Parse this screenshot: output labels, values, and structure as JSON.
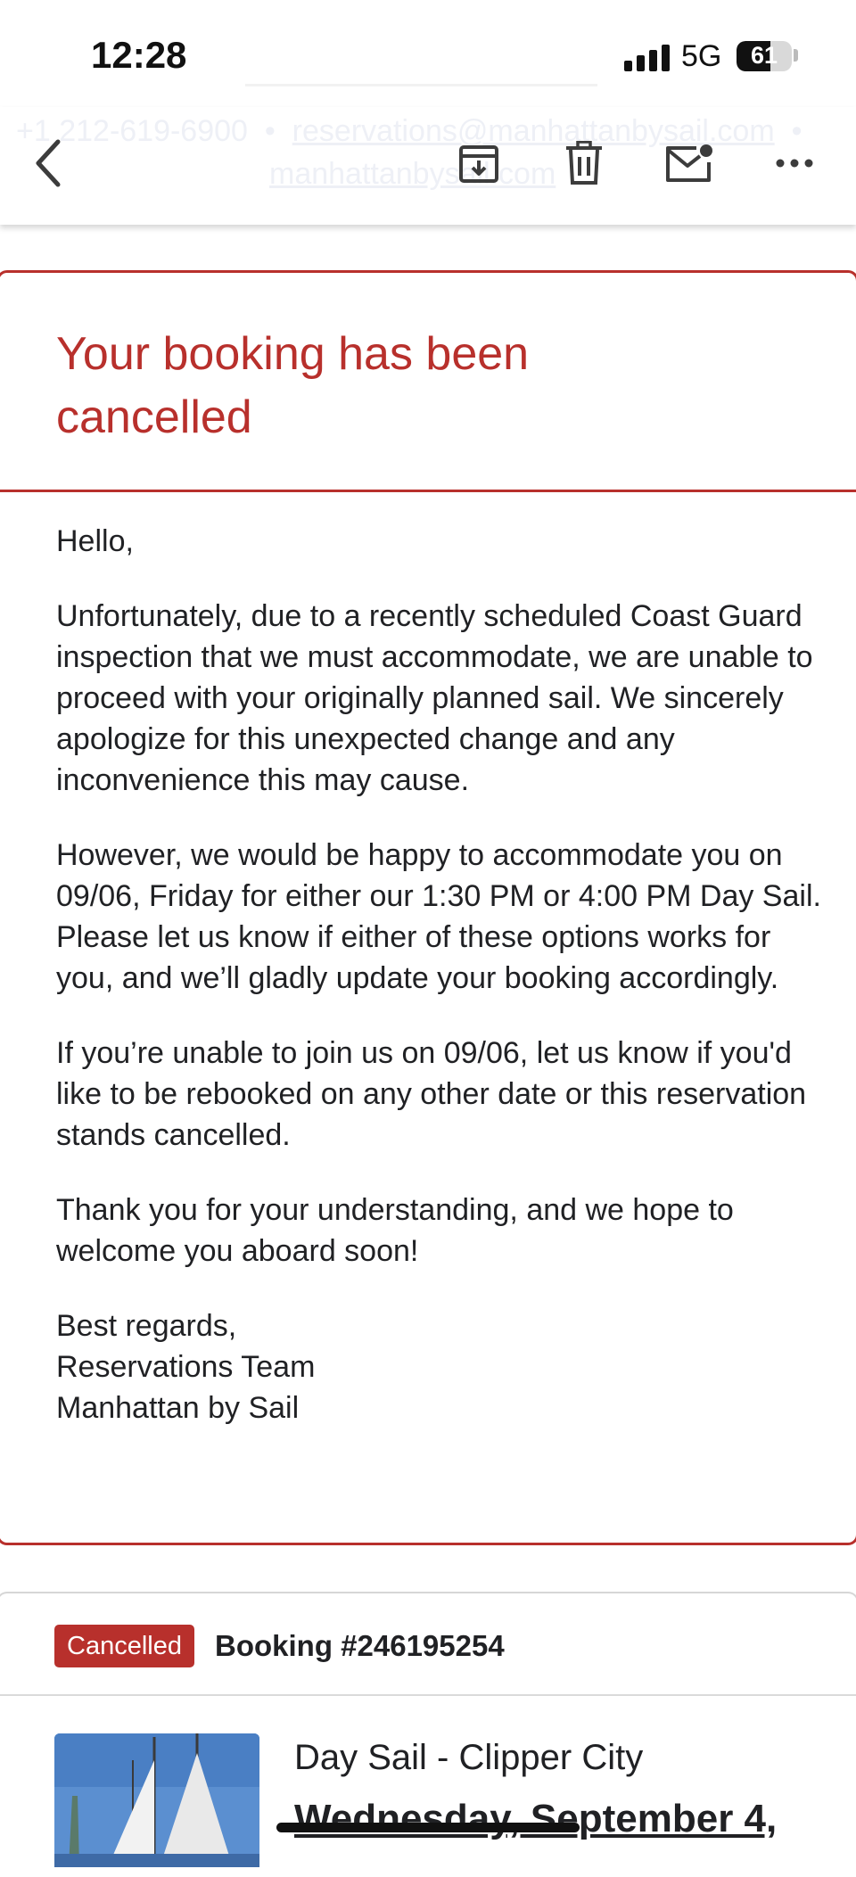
{
  "status_bar": {
    "time": "12:28",
    "network": "5G",
    "battery": "61",
    "battery_level": 0.61
  },
  "background_header": {
    "phone": "+1 212-619-6900",
    "separator": "•",
    "email": "reservations@manhattanbysail.com",
    "website": "manhattanbysail.com"
  },
  "toolbar": {
    "icons": [
      "back-arrow-icon",
      "archive-icon",
      "trash-icon",
      "mark-unread-icon",
      "more-icon"
    ]
  },
  "cancellation": {
    "title": "Your booking has been cancelled",
    "greeting": "Hello,",
    "paragraph_1": "Unfortunately, due to a recently scheduled Coast Guard inspection that we must accommodate, we are unable to proceed with your originally planned sail. We sincerely apologize for this unexpected change and any inconvenience this may cause.",
    "paragraph_2": "However, we would be happy to accommodate you on 09/06, Friday for either our 1:30 PM or 4:00 PM Day Sail. Please let us know if either of these options works for you, and we’ll gladly update your booking accordingly.",
    "paragraph_3": "If you’re unable to join us on 09/06, let us know if you'd like to be rebooked on any other date or this reservation stands cancelled.",
    "paragraph_4": "Thank you for your understanding, and we hope to welcome you aboard soon!",
    "signoff": "Best regards,",
    "team": "Reservations Team",
    "company": "Manhattan by Sail"
  },
  "booking": {
    "status_badge": "Cancelled",
    "number": "Booking #246195254",
    "trip_name": "Day Sail - Clipper City",
    "date": "Wednesday, September 4,"
  },
  "colors": {
    "accent": "#b8302c",
    "text": "#202124"
  }
}
